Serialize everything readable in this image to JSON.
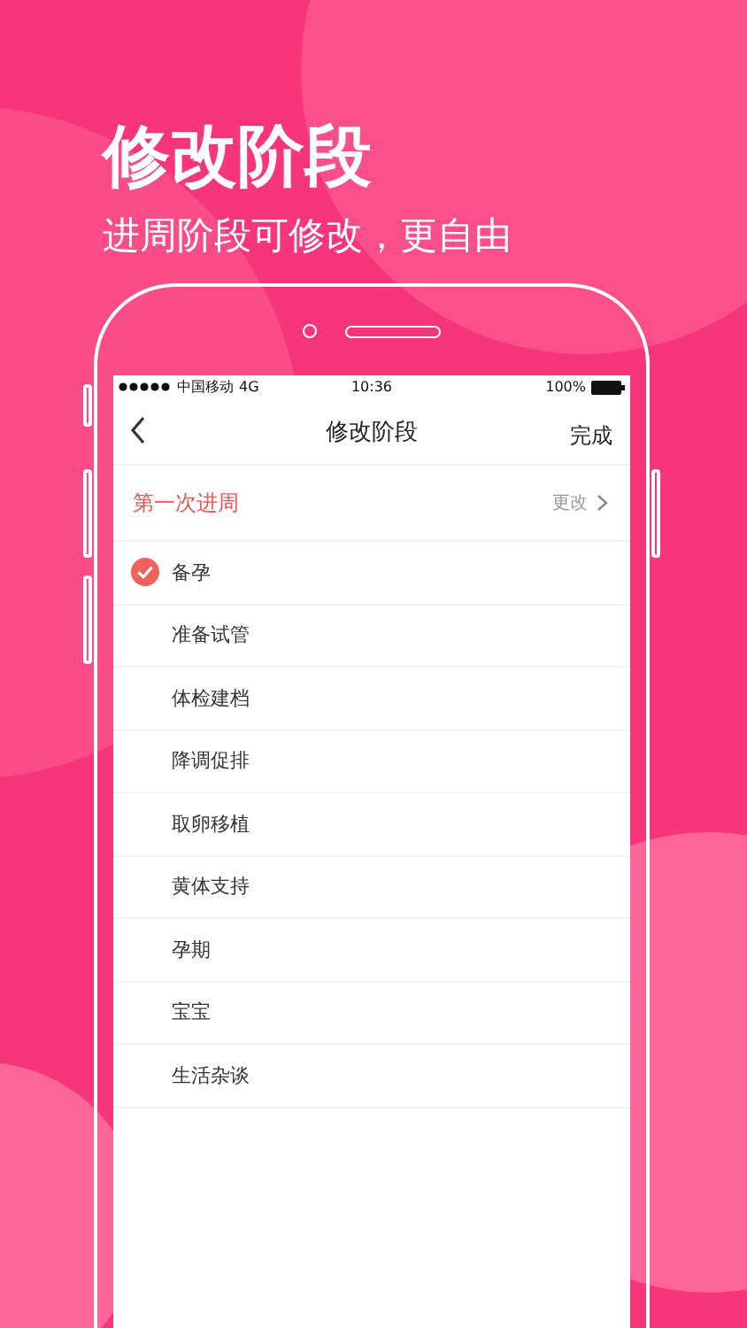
{
  "headline": "修改阶段",
  "subtitle": "进周阶段可修改，更自由",
  "status_bar": {
    "carrier": "中国移动",
    "network": "4G",
    "time": "10:36",
    "battery": "100%"
  },
  "nav": {
    "title": "修改阶段",
    "done": "完成"
  },
  "cycle": {
    "label": "第一次进周",
    "action": "更改"
  },
  "stages": [
    {
      "label": "备孕",
      "selected": true
    },
    {
      "label": "准备试管",
      "selected": false
    },
    {
      "label": "体检建档",
      "selected": false
    },
    {
      "label": "降调促排",
      "selected": false
    },
    {
      "label": "取卵移植",
      "selected": false
    },
    {
      "label": "黄体支持",
      "selected": false
    },
    {
      "label": "孕期",
      "selected": false
    },
    {
      "label": "宝宝",
      "selected": false
    },
    {
      "label": "生活杂谈",
      "selected": false
    }
  ]
}
